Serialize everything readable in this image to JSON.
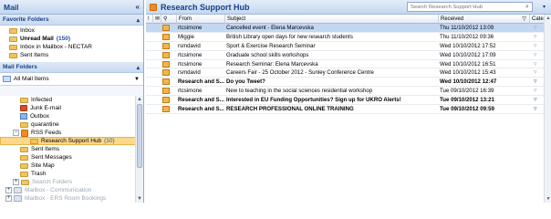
{
  "nav": {
    "title": "Mail",
    "collapse_glyph": "«",
    "favorites": {
      "header": "Favorite Folders",
      "items": [
        {
          "label": "Inbox",
          "count": "",
          "bold": false
        },
        {
          "label": "Unread Mail",
          "count": "(150)",
          "bold": true
        },
        {
          "label": "Inbox in Mailbox - NECTAR",
          "count": "",
          "bold": false
        },
        {
          "label": "Sent Items",
          "count": "",
          "bold": false
        }
      ]
    },
    "mail_folders": {
      "header": "Mail Folders",
      "all_items_label": "All Mail Items"
    },
    "tree": [
      {
        "label": "Infected",
        "icon": "folder-icon",
        "indent": 22,
        "expander": "",
        "faded": false
      },
      {
        "label": "Junk E-mail",
        "icon": "junk-icon",
        "indent": 22,
        "expander": "",
        "faded": false
      },
      {
        "label": "Outbox",
        "icon": "outbox-icon",
        "indent": 22,
        "expander": "",
        "faded": false
      },
      {
        "label": "quarantine",
        "icon": "folder-icon",
        "indent": 22,
        "expander": "",
        "faded": false
      },
      {
        "label": "RSS Feeds",
        "icon": "rss-icon",
        "indent": 14,
        "expander": "−",
        "faded": false
      },
      {
        "label": "Research Support Hub",
        "icon": "folder-icon",
        "indent": 32,
        "expander": "",
        "faded": false,
        "selected": true,
        "count": "(10)"
      },
      {
        "label": "Sent Items",
        "icon": "folder-icon",
        "indent": 22,
        "expander": "",
        "faded": false
      },
      {
        "label": "Sent Messages",
        "icon": "folder-icon",
        "indent": 22,
        "expander": "",
        "faded": false
      },
      {
        "label": "Site Map",
        "icon": "folder-icon",
        "indent": 22,
        "expander": "",
        "faded": false
      },
      {
        "label": "Trash",
        "icon": "folder-icon",
        "indent": 22,
        "expander": "",
        "faded": false
      },
      {
        "label": "Search Folders",
        "icon": "search-folder-icon",
        "indent": 14,
        "expander": "+",
        "faded": true
      },
      {
        "label": "Mailbox - Communication",
        "icon": "mailbox-icon",
        "indent": 6,
        "expander": "+",
        "faded": true
      },
      {
        "label": "Mailbox - ERS Room Bookings",
        "icon": "mailbox-icon",
        "indent": 6,
        "expander": "+",
        "faded": true
      }
    ]
  },
  "main": {
    "title": "Research Support Hub",
    "search": {
      "placeholder": "Search Research Support Hub",
      "value": ""
    },
    "columns": {
      "importance": "!",
      "type": "",
      "attachment": "",
      "from": "From",
      "subject": "Subject",
      "received": "Received",
      "categories": "Cate..."
    },
    "messages": [
      {
        "from": "rtcsimone",
        "subject": "Cancelled event - Elena Marcevska",
        "received": "Thu 11/10/2012 13:09",
        "selected": true,
        "bold": false
      },
      {
        "from": "Miggie",
        "subject": "British Library open days for new research students",
        "received": "Thu 11/10/2012 09:36",
        "selected": false,
        "bold": false
      },
      {
        "from": "rsmdavid",
        "subject": "Sport & Exercise Research Seminar",
        "received": "Wed 10/10/2012 17:52",
        "selected": false,
        "bold": false
      },
      {
        "from": "rtcsimone",
        "subject": "Graduate school skills workshops",
        "received": "Wed 10/10/2012 17:09",
        "selected": false,
        "bold": false
      },
      {
        "from": "rtcsimone",
        "subject": "Research Seminar: Elena Marcevska",
        "received": "Wed 10/10/2012 16:51",
        "selected": false,
        "bold": false
      },
      {
        "from": "rsmdavid",
        "subject": "Careers Fair - 25 October 2012 - Sunley Conference Centre",
        "received": "Wed 10/10/2012 15:43",
        "selected": false,
        "bold": false
      },
      {
        "from": "Research and S...",
        "subject": "Do you Tweet?",
        "received": "Wed 10/10/2012 12:47",
        "selected": false,
        "bold": true
      },
      {
        "from": "rtcsimone",
        "subject": "New to teaching in the social sciences residential workshop",
        "received": "Tue 09/10/2012 16:39",
        "selected": false,
        "bold": false
      },
      {
        "from": "Research and S...",
        "subject": "Interested in EU Funding Opportunities? Sign up for UKRO Alerts!",
        "received": "Tue 09/10/2012 13:21",
        "selected": false,
        "bold": true
      },
      {
        "from": "Research and S...",
        "subject": "RESEARCH PROFESSIONAL ONLINE TRAINING",
        "received": "Tue 09/10/2012 09:59",
        "selected": false,
        "bold": true
      }
    ]
  },
  "colors": {
    "header_blue": "#15428b",
    "selection": "#c2d7f2",
    "folder_selected": "#fdd88a"
  }
}
